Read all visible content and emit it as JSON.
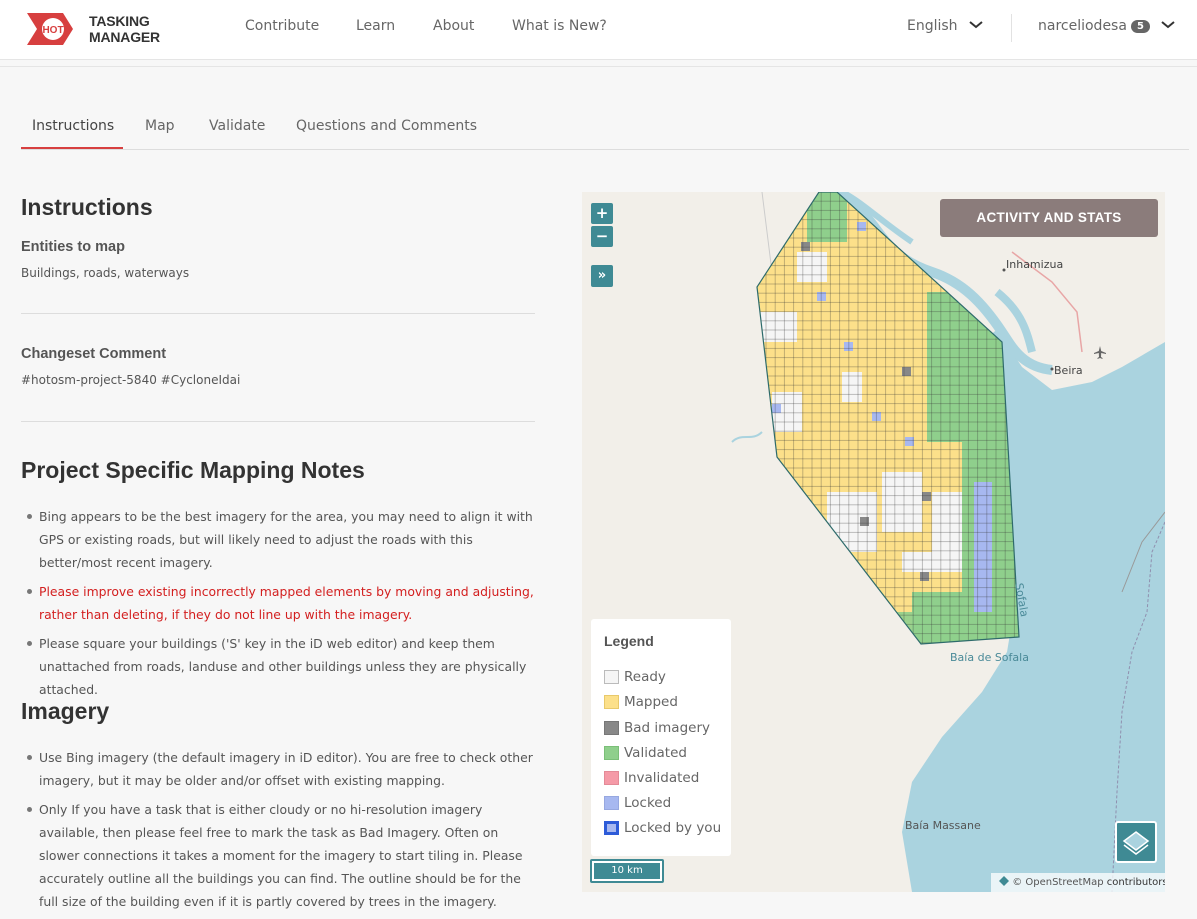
{
  "header": {
    "logo_badge": "HOT",
    "logo_text": "TASKING MANAGER",
    "nav": [
      "Contribute",
      "Learn",
      "About",
      "What is New?"
    ],
    "language": "English",
    "username": "narceliodesa",
    "notifications": "5"
  },
  "tabs": [
    "Instructions",
    "Map",
    "Validate",
    "Questions and Comments"
  ],
  "instructions": {
    "title": "Instructions",
    "entities_label": "Entities to map",
    "entities_value": "Buildings, roads, waterways",
    "changeset_label": "Changeset Comment",
    "changeset_value": "#hotosm-project-5840 #CycloneIdai",
    "notes_title": "Project Specific Mapping Notes",
    "notes": [
      "Bing appears to be the best imagery for the area, you may need to align it with GPS or existing roads, but will likely need to adjust the roads with this better/most recent imagery.",
      "Please improve existing incorrectly mapped elements by moving and adjusting, rather than deleting, if they do not line up with the imagery.",
      "Please square your buildings ('S' key in the iD web editor) and keep them unattached from roads, landuse and other buildings unless they are physically attached."
    ],
    "imagery_title": "Imagery",
    "imagery_notes": [
      "Use Bing imagery (the default imagery in iD editor). You are free to check other imagery, but it may be older and/or offset with existing mapping.",
      "Only If you have a task that is either cloudy or no hi-resolution imagery available, then please feel free to mark the task as Bad Imagery. Often on slower connections it takes a moment for the imagery to start tiling in. Please accurately outline all the buildings you can find. The outline should be for the full size of the building even if it is partly covered by trees in the imagery."
    ]
  },
  "map": {
    "zoom_in": "+",
    "zoom_out": "−",
    "expand": "»",
    "stats_button": "ACTIVITY AND STATS",
    "legend_title": "Legend",
    "legend": [
      {
        "label": "Ready",
        "color": "#f5f5f5"
      },
      {
        "label": "Mapped",
        "color": "#fce08a"
      },
      {
        "label": "Bad imagery",
        "color": "#888888"
      },
      {
        "label": "Validated",
        "color": "#8fcf8c"
      },
      {
        "label": "Invalidated",
        "color": "#f59aa7"
      },
      {
        "label": "Locked",
        "color": "#a7b8f0"
      },
      {
        "label": "Locked by you",
        "color": "#a7b8f0"
      }
    ],
    "scale": "10 km",
    "attribution_prefix": "© ",
    "attribution_link": "OpenStreetMap",
    "attribution_suffix": " contributors",
    "places": [
      "Inhamizua",
      "Beira",
      "Baía de Sofala",
      "Baía Massane",
      "Sofala"
    ]
  },
  "colors": {
    "accent": "#d73f3f",
    "map_control": "#3f8a94",
    "stats_button": "#8b7c7b",
    "sea": "#aad3df"
  }
}
